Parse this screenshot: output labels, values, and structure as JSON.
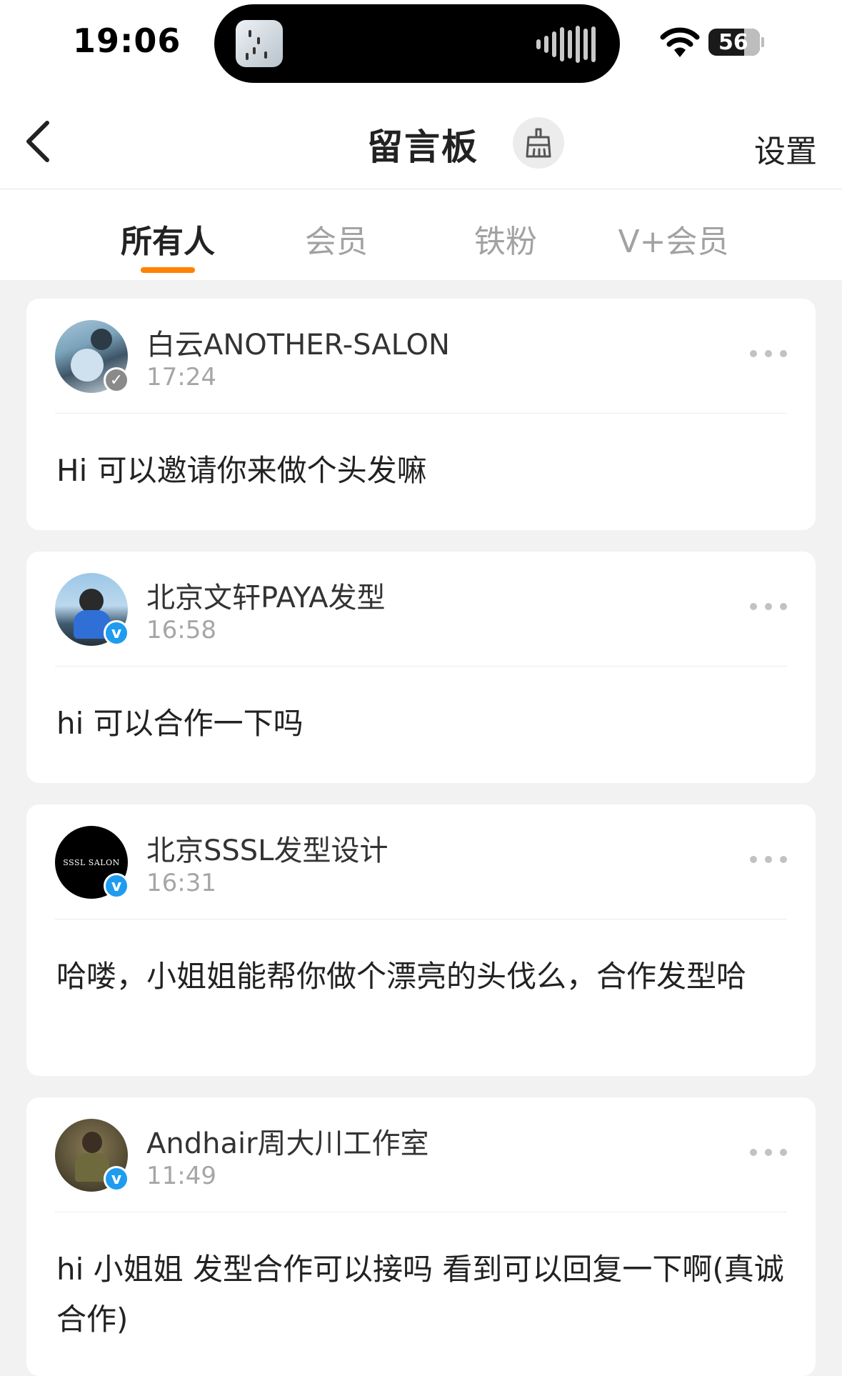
{
  "status_bar": {
    "time": "19:06",
    "battery": "56"
  },
  "nav": {
    "title": "留言板",
    "settings": "设置"
  },
  "tabs": [
    {
      "label": "所有人",
      "active": true
    },
    {
      "label": "会员",
      "active": false
    },
    {
      "label": "铁粉",
      "active": false
    },
    {
      "label": "V+会员",
      "active": false
    }
  ],
  "messages": [
    {
      "name": "白云ANOTHER-SALON",
      "time": "17:24",
      "text": "Hi  可以邀请你来做个头发嘛",
      "badge": "gray"
    },
    {
      "name": "北京文轩PAYA发型",
      "time": "16:58",
      "text": "hi  可以合作一下吗",
      "badge": "blue"
    },
    {
      "name": "北京SSSL发型设计",
      "time": "16:31",
      "text": "哈喽，小姐姐能帮你做个漂亮的头伐么，合作发型哈",
      "badge": "blue",
      "avatar_text": "SSSL SALON"
    },
    {
      "name": "Andhair周大川工作室",
      "time": "11:49",
      "text": "hi 小姐姐 发型合作可以接吗 看到可以回复一下啊(真诚合作)",
      "badge": "blue"
    }
  ],
  "colors": {
    "accent": "#ff8200",
    "verified_blue": "#1f9cf0",
    "background": "#f2f2f2"
  }
}
